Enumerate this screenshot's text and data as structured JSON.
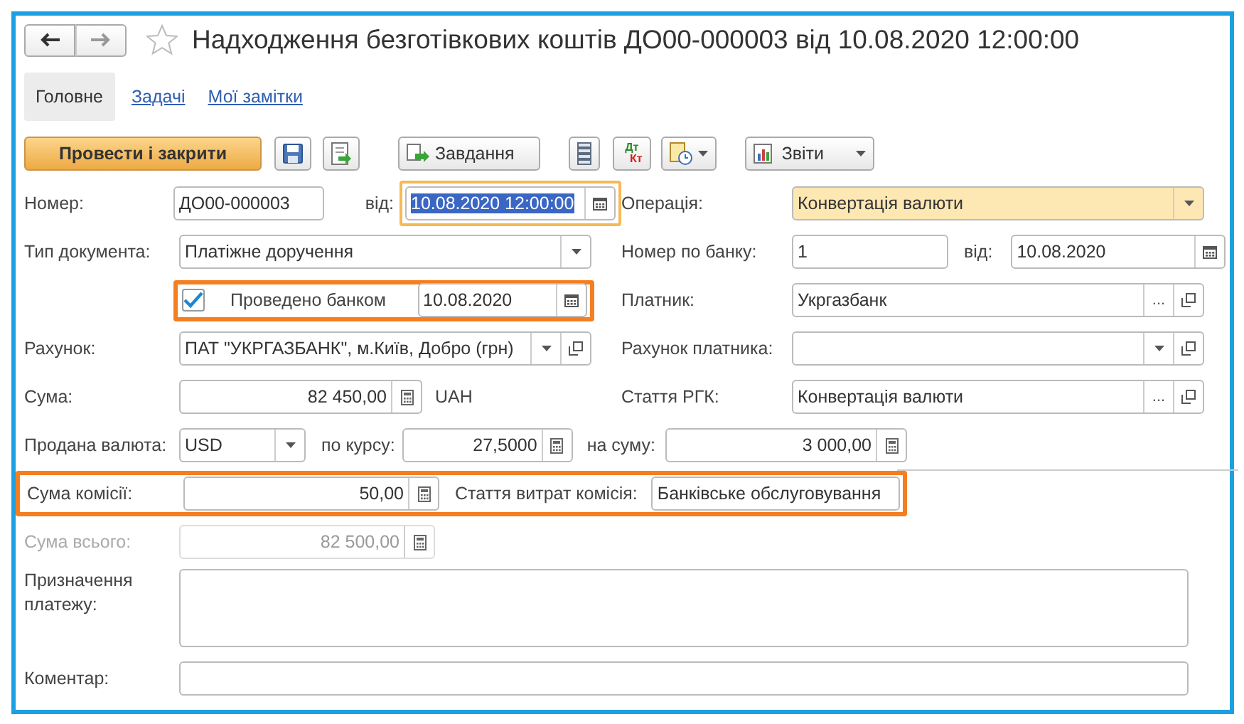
{
  "window": {
    "title": "Надходження безготівкових коштів ДО00-000003 від 10.08.2020 12:00:00",
    "favorite": false
  },
  "tabs": [
    {
      "label": "Головне",
      "selected": true
    },
    {
      "label": "Задачі",
      "selected": false
    },
    {
      "label": "Мої замітки",
      "selected": false
    }
  ],
  "toolbar": {
    "post_close": "Провести і закрити",
    "tasks": "Завдання",
    "dt": "Дт",
    "kt": "Кт",
    "reports": "Звіти"
  },
  "fields": {
    "number": {
      "label": "Номер:",
      "value": "ДО00-000003"
    },
    "date": {
      "label": "від:",
      "value": "10.08.2020 12:00:00",
      "text_selected": true,
      "framed": true
    },
    "operation": {
      "label": "Операція:",
      "value": "Конвертація валюти",
      "highlighted": true
    },
    "doc_type": {
      "label": "Тип документа:",
      "value": "Платіжне доручення"
    },
    "bank_number": {
      "label": "Номер по банку:",
      "value": "1"
    },
    "bank_date": {
      "label": "від:",
      "value": "10.08.2020"
    },
    "posted": {
      "label": "Проведено банком",
      "checked": true,
      "value": "10.08.2020",
      "framed": true
    },
    "payer": {
      "label": "Платник:",
      "value": "Укргазбанк",
      "choice": "..."
    },
    "account": {
      "label": "Рахунок:",
      "value": "ПАТ \"УКРГАЗБАНК\", м.Київ, Добро (грн)"
    },
    "payer_account": {
      "label": "Рахунок платника:"
    },
    "amount": {
      "label": "Сума:",
      "value": "82 450,00",
      "currency": "UAH"
    },
    "cash_item": {
      "label": "Стаття РГК:",
      "value": "Конвертація валюти",
      "choice": "..."
    },
    "sold_currency": {
      "label": "Продана валюта:",
      "value": "USD"
    },
    "rate": {
      "label": "по курсу:",
      "value": "27,5000"
    },
    "sold_amount": {
      "label": "на суму:",
      "value": "3 000,00"
    },
    "commission": {
      "label": "Сума комісії:",
      "value": "50,00",
      "framed": true
    },
    "commission_item": {
      "label": "Стаття витрат комісія:",
      "value": "Банківське обслуговування"
    },
    "total": {
      "label": "Сума всього:",
      "value": "82 500,00",
      "disabled": true
    },
    "purpose": {
      "label": "Призначення платежу:"
    },
    "comment": {
      "label": "Коментар:"
    }
  }
}
